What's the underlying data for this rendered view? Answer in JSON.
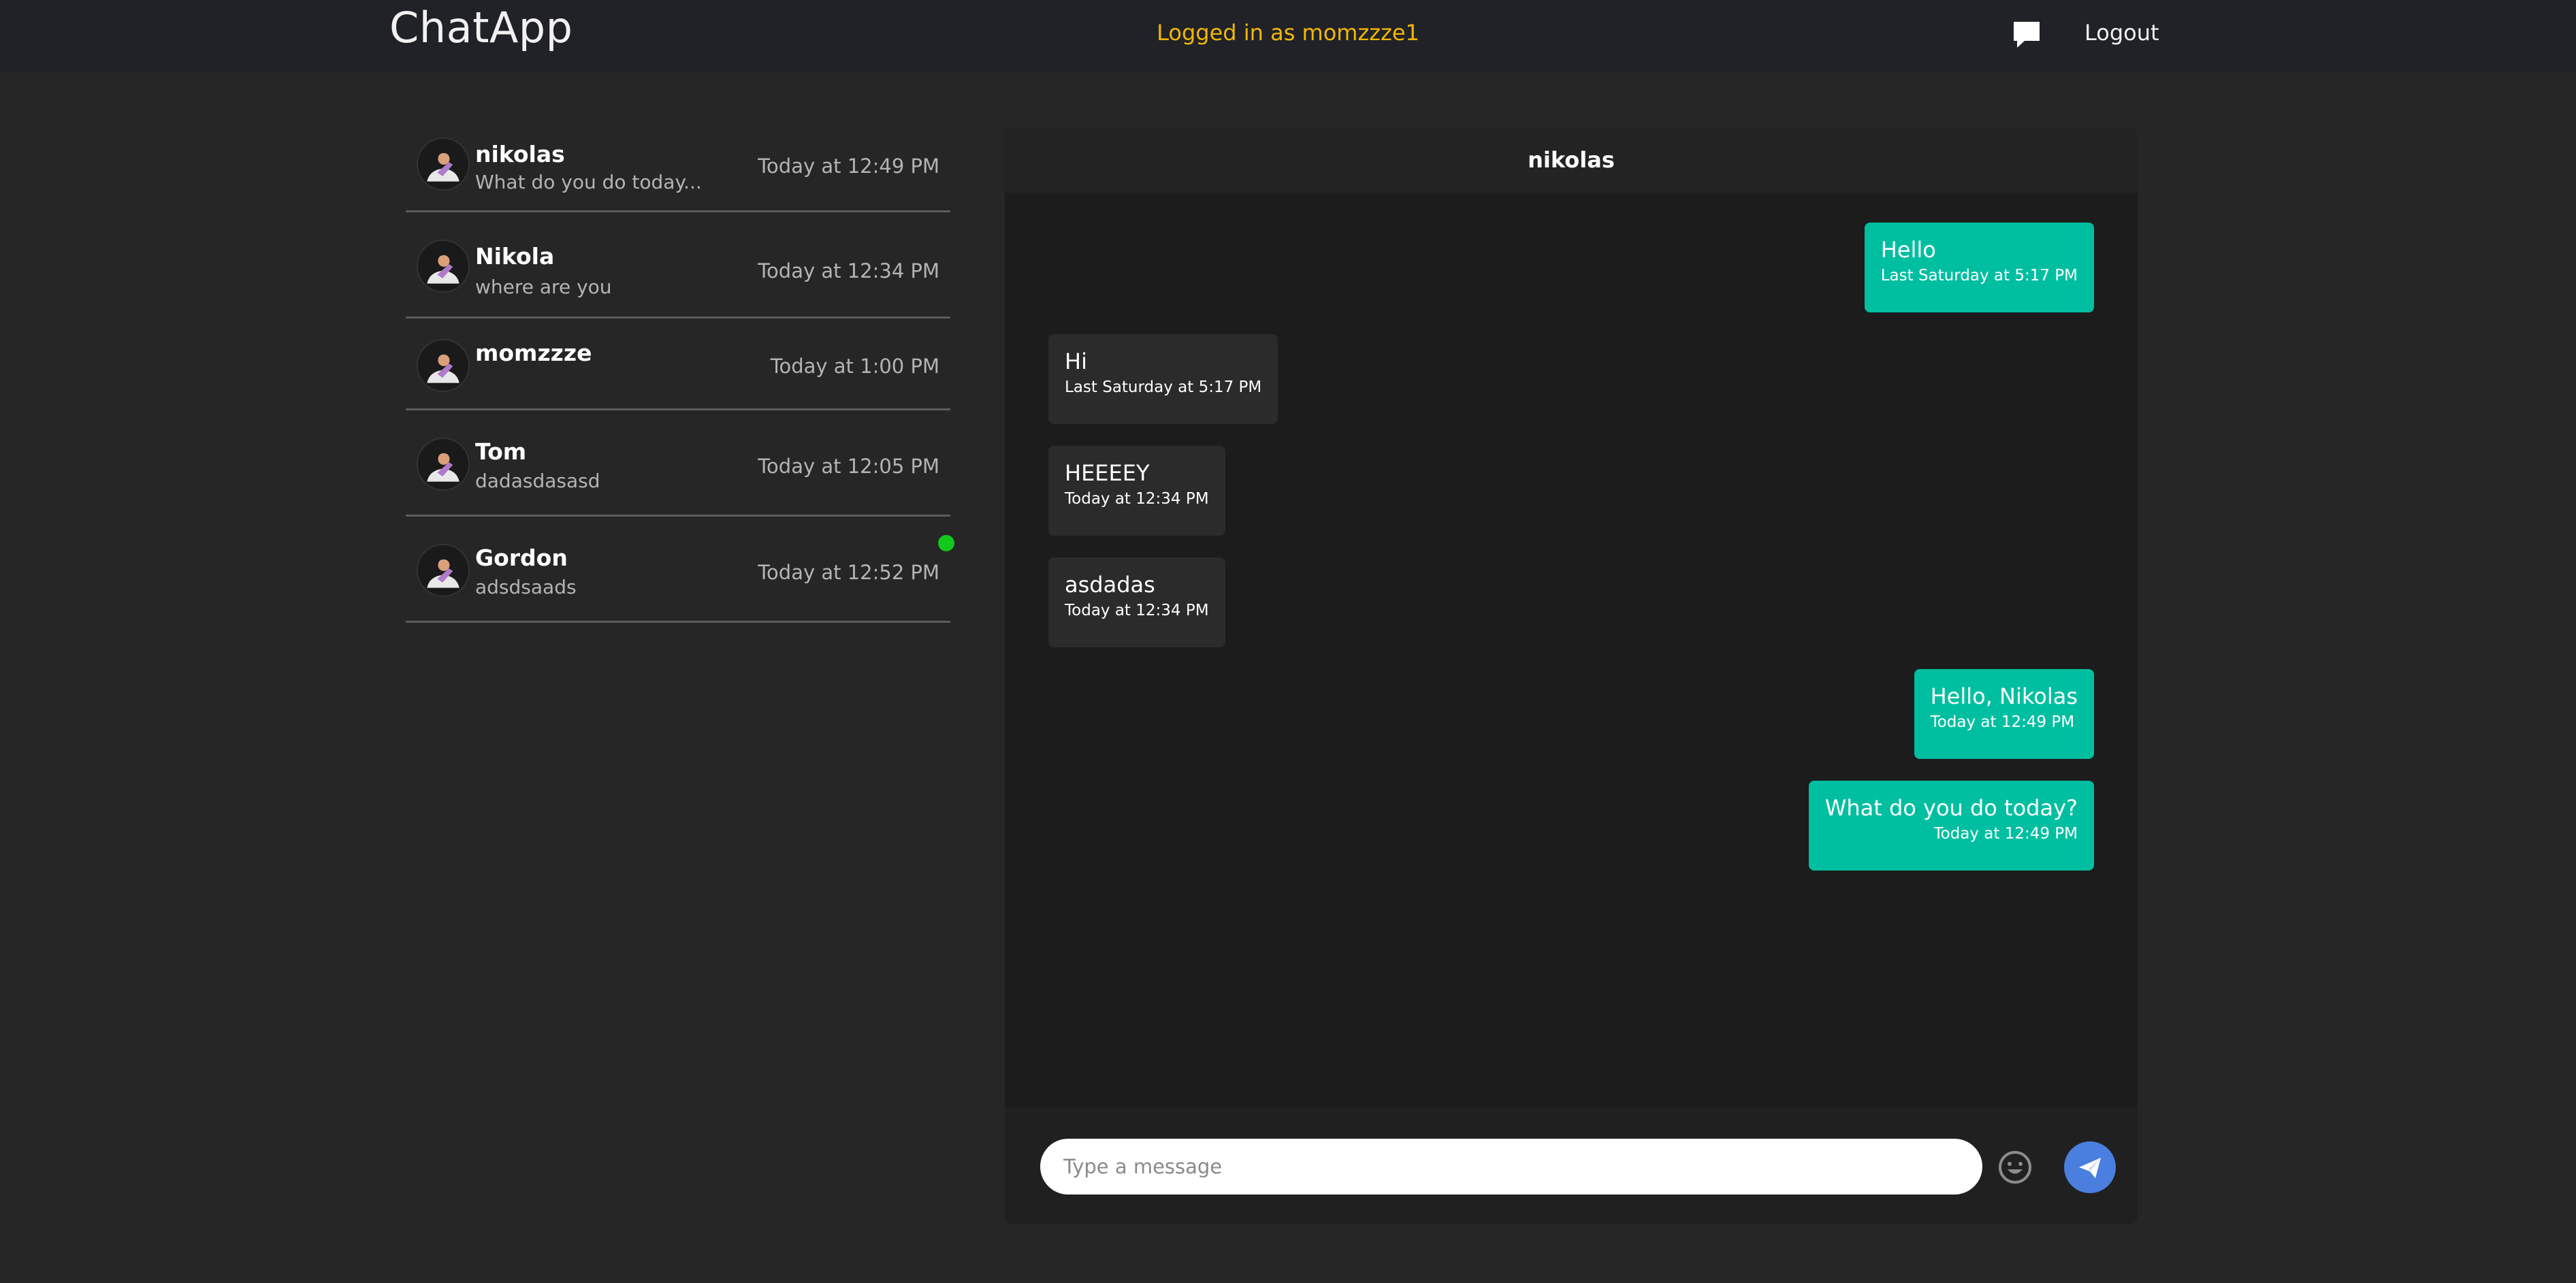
{
  "app": {
    "brand": "ChatApp",
    "logged_in_text": "Logged in as momzzze1",
    "logout_label": "Logout",
    "chat_icon": "chat-bubble-icon"
  },
  "conversations": [
    {
      "name": "nikolas",
      "preview": "What do you do today...",
      "time": "Today at 12:49 PM",
      "online": false
    },
    {
      "name": "Nikola",
      "preview": "where are you",
      "time": "Today at 12:34 PM",
      "online": false
    },
    {
      "name": "momzzze",
      "preview": "",
      "time": "Today at 1:00 PM",
      "online": false
    },
    {
      "name": "Tom",
      "preview": "dadasdasasd",
      "time": "Today at 12:05 PM",
      "online": false
    },
    {
      "name": "Gordon",
      "preview": "adsdsaads",
      "time": "Today at 12:52 PM",
      "online": true
    }
  ],
  "chat": {
    "title": "nikolas",
    "messages": [
      {
        "direction": "out",
        "text": "Hello",
        "time": "Last Saturday at 5:17 PM"
      },
      {
        "direction": "in",
        "text": "Hi",
        "time": "Last Saturday at 5:17 PM"
      },
      {
        "direction": "in",
        "text": "HEEEEY",
        "time": "Today at 12:34 PM"
      },
      {
        "direction": "in",
        "text": "asdadas",
        "time": "Today at 12:34 PM"
      },
      {
        "direction": "out",
        "text": "Hello, Nikolas",
        "time": "Today at 12:49 PM"
      },
      {
        "direction": "out",
        "text": "What do you do today?",
        "time": "Today at 12:49 PM"
      }
    ],
    "input_placeholder": "Type a message",
    "input_value": "",
    "emoji_icon": "smiley-icon",
    "send_icon": "paper-plane-icon"
  },
  "colors": {
    "navbar_bg": "#202227",
    "page_bg": "#262626",
    "accent_logged_in": "#f2b705",
    "outgoing_bubble": "#00bfa0",
    "incoming_bubble": "#2b2b2b",
    "send_button": "#4a7fe0",
    "online_indicator": "#11c81b"
  }
}
